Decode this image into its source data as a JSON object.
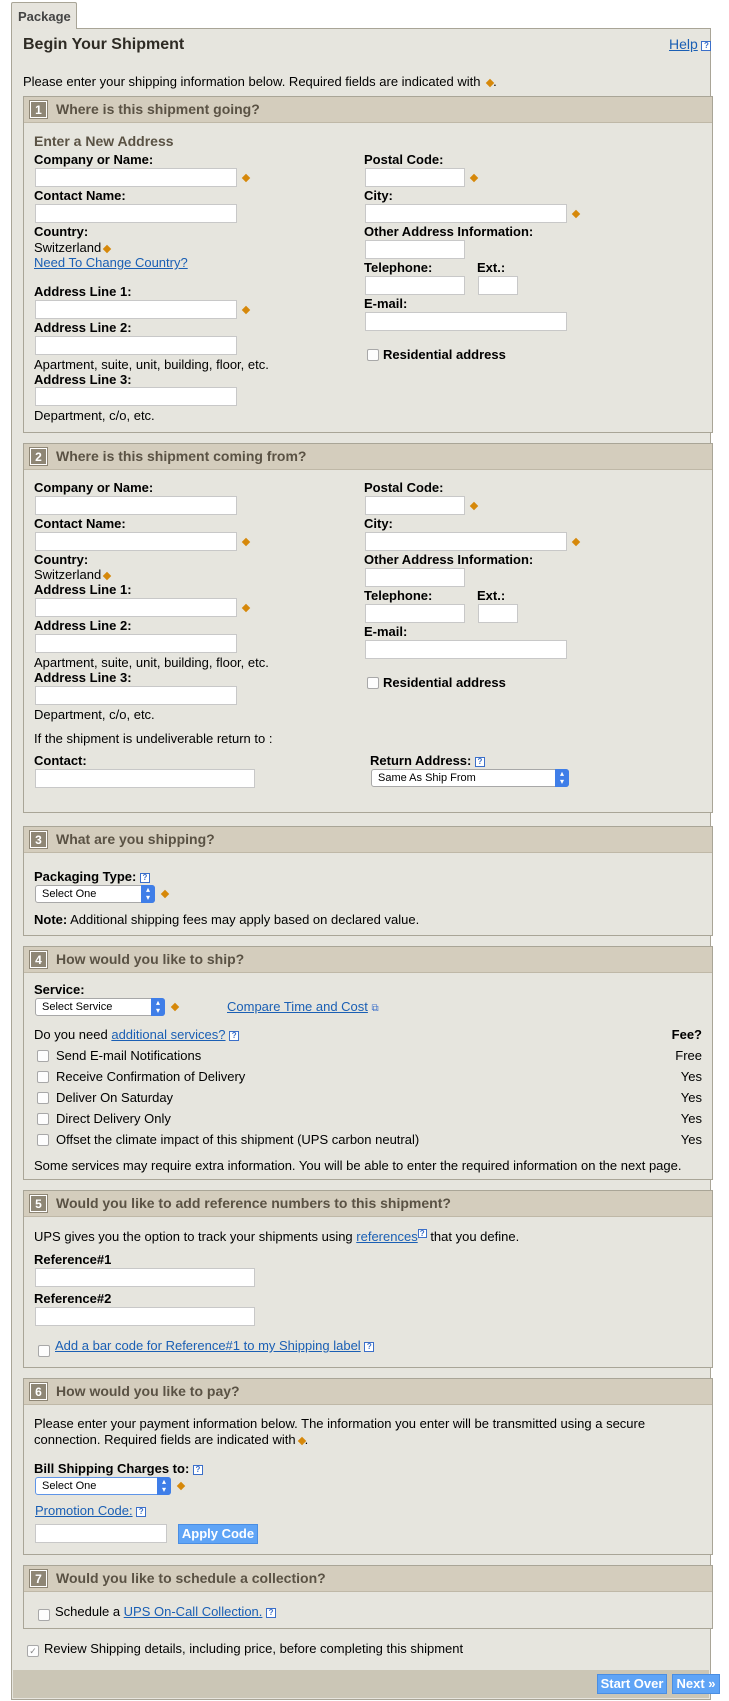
{
  "tab_label": "Package",
  "page_title": "Begin Your Shipment",
  "help_label": "Help",
  "intro_text": "Please enter your shipping information below. Required fields are indicated with",
  "intro_end": ".",
  "icons": {
    "help": "help-icon",
    "required": "required-diamond-icon",
    "popup": "popup-window-icon"
  },
  "colors": {
    "required": "#d6880a",
    "link": "#1a5fb4",
    "section_header": "#d4cdbd",
    "button": "#5fa4f6"
  },
  "s1": {
    "num": "1",
    "title": "Where is this shipment going?",
    "subtitle": "Enter a New Address",
    "company": "Company or Name:",
    "contact": "Contact Name:",
    "country_label": "Country:",
    "country_value": "Switzerland",
    "change_country": "Need To Change Country?",
    "addr1": "Address Line 1:",
    "addr2": "Address Line 2:",
    "addr2_hint": "Apartment, suite, unit, building, floor, etc.",
    "addr3": "Address Line 3:",
    "addr3_hint": "Department, c/o, etc.",
    "postal": "Postal Code:",
    "city": "City:",
    "other": "Other Address Information:",
    "phone": "Telephone:",
    "ext": "Ext.:",
    "email": "E-mail:",
    "residential": "Residential address"
  },
  "s2": {
    "num": "2",
    "title": "Where is this shipment coming from?",
    "company": "Company or Name:",
    "contact": "Contact Name:",
    "country_label": "Country:",
    "country_value": "Switzerland",
    "addr1": "Address Line 1:",
    "addr2": "Address Line 2:",
    "addr2_hint": "Apartment, suite, unit, building, floor, etc.",
    "addr3": "Address Line 3:",
    "addr3_hint": "Department, c/o, etc.",
    "postal": "Postal Code:",
    "city": "City:",
    "other": "Other Address Information:",
    "phone": "Telephone:",
    "ext": "Ext.:",
    "email": "E-mail:",
    "residential": "Residential address",
    "undeliverable": "If the shipment is undeliverable return to :",
    "return_contact": "Contact:",
    "return_address": "Return Address:",
    "return_address_value": "Same As Ship From"
  },
  "s3": {
    "num": "3",
    "title": "What are you shipping?",
    "packaging": "Packaging Type:",
    "packaging_value": "Select One",
    "note_bold": "Note:",
    "note": " Additional shipping fees may apply based on declared value."
  },
  "s4": {
    "num": "4",
    "title": "How would you like to ship?",
    "service": "Service:",
    "service_value": "Select Service",
    "compare": "Compare Time and Cost",
    "need_prefix": "Do you need ",
    "need_link": "additional services?",
    "fee_header": "Fee?",
    "options": [
      {
        "label": "Send E-mail Notifications",
        "fee": "Free"
      },
      {
        "label": "Receive Confirmation of Delivery",
        "fee": "Yes"
      },
      {
        "label": "Deliver On Saturday",
        "fee": "Yes"
      },
      {
        "label": "Direct Delivery Only",
        "fee": "Yes"
      },
      {
        "label": "Offset the climate impact of this shipment (UPS carbon neutral)",
        "fee": "Yes"
      }
    ],
    "footnote": "Some services may require extra information. You will be able to enter the required information on the next page."
  },
  "s5": {
    "num": "5",
    "title": "Would you like to add reference numbers to this shipment?",
    "intro_prefix": "UPS gives you the option to track your shipments using ",
    "intro_link": "references",
    "intro_suffix": " that you define.",
    "ref1": "Reference#1",
    "ref2": "Reference#2",
    "barcode": "Add a bar code for Reference#1 to my Shipping label"
  },
  "s6": {
    "num": "6",
    "title": "How would you like to pay?",
    "intro1": "Please enter your payment information below. The information you enter will be transmitted using a secure",
    "intro2": "connection. Required fields are indicated with",
    "intro2_end": ".",
    "bill": "Bill Shipping Charges to:",
    "bill_value": "Select One",
    "promo": "Promotion Code:",
    "apply": "Apply Code"
  },
  "s7": {
    "num": "7",
    "title": "Would you like to schedule a collection?",
    "schedule_prefix": "Schedule a ",
    "schedule_link": "UPS On-Call Collection."
  },
  "review": "Review Shipping details, including price, before completing this shipment",
  "footer": {
    "start_over": "Start Over",
    "next": "Next"
  }
}
